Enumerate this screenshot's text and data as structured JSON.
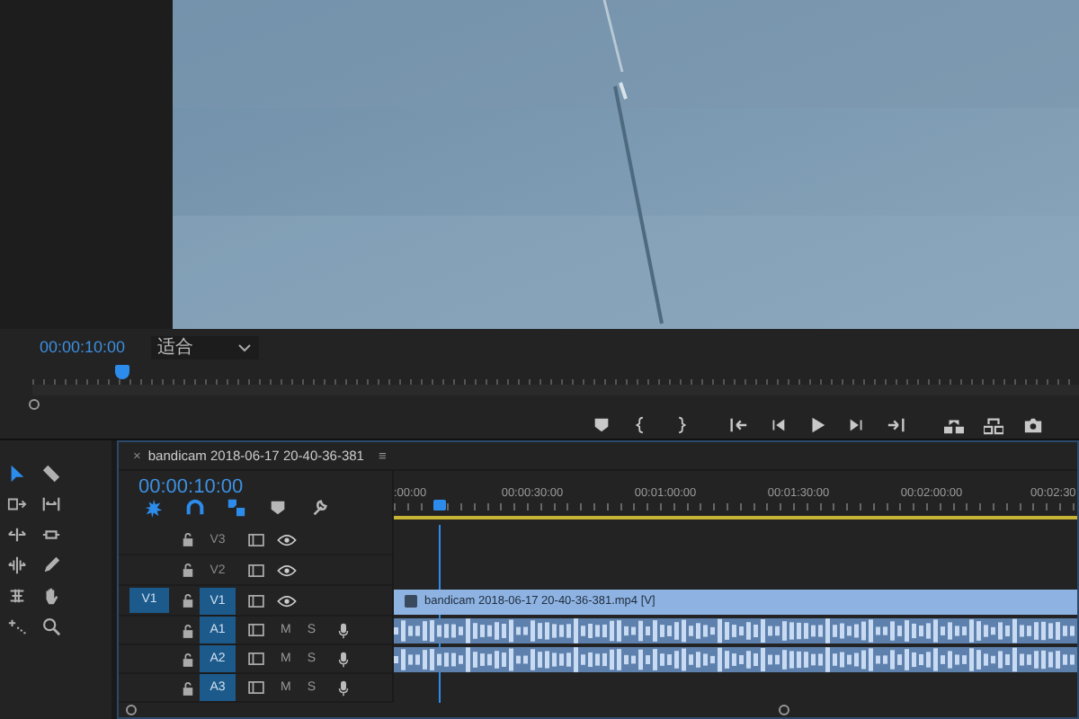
{
  "program_monitor": {
    "timecode": "00:00:10:00",
    "fit_dropdown": "适合",
    "playhead": {
      "level": 0.086
    },
    "transport_buttons": [
      {
        "kind": "marker"
      },
      {
        "kind": "mark-in"
      },
      {
        "kind": "mark-out"
      },
      {
        "kind": "go-to-in"
      },
      {
        "kind": "step-back"
      },
      {
        "kind": "play"
      },
      {
        "kind": "step-forward"
      },
      {
        "kind": "go-to-out"
      },
      {
        "kind": "insert"
      },
      {
        "kind": "overwrite"
      },
      {
        "kind": "export-frame"
      }
    ]
  },
  "tools": [
    {
      "kind": "selection",
      "selected": true
    },
    {
      "kind": "razor",
      "selected": false
    },
    {
      "kind": "track-select",
      "selected": false
    },
    {
      "kind": "ripple",
      "selected": false
    },
    {
      "kind": "rolling",
      "selected": false
    },
    {
      "kind": "stretch",
      "selected": false
    },
    {
      "kind": "slip",
      "selected": false
    },
    {
      "kind": "pen",
      "selected": false
    },
    {
      "kind": "slide",
      "selected": false
    },
    {
      "kind": "hand",
      "selected": false
    },
    {
      "kind": "type",
      "selected": false
    },
    {
      "kind": "zoom",
      "selected": false
    }
  ],
  "timeline": {
    "tab": {
      "close": "×",
      "title": "bandicam 2018-06-17 20-40-36-381",
      "menu": "≡"
    },
    "timecode": "00:00:10:00",
    "toolbar": [
      {
        "kind": "nest",
        "on": true
      },
      {
        "kind": "snap",
        "on": true
      },
      {
        "kind": "linked",
        "on": true
      },
      {
        "kind": "marker",
        "on": false
      },
      {
        "kind": "settings",
        "on": false
      }
    ],
    "ruler_labels": [
      ":00:00",
      "00:00:30:00",
      "00:01:00:00",
      "00:01:30:00",
      "00:02:00:00",
      "00:02:30"
    ],
    "playhead": {
      "level": 0.065
    },
    "tracks": [
      {
        "name": "V3",
        "kind": "video",
        "selected": false
      },
      {
        "name": "V2",
        "kind": "video",
        "selected": false
      },
      {
        "name": "V1",
        "kind": "video",
        "selected": true,
        "source": "V1",
        "clip": {
          "label": "bandicam 2018-06-17 20-40-36-381.mp4 [V]"
        }
      },
      {
        "name": "A1",
        "kind": "audio",
        "selected": true,
        "mute": "M",
        "solo": "S",
        "clip": {
          "kind": "audio"
        }
      },
      {
        "name": "A2",
        "kind": "audio",
        "selected": true,
        "mute": "M",
        "solo": "S",
        "clip": {
          "kind": "audio"
        }
      },
      {
        "name": "A3",
        "kind": "audio",
        "selected": true,
        "mute": "M",
        "solo": "S"
      }
    ]
  }
}
